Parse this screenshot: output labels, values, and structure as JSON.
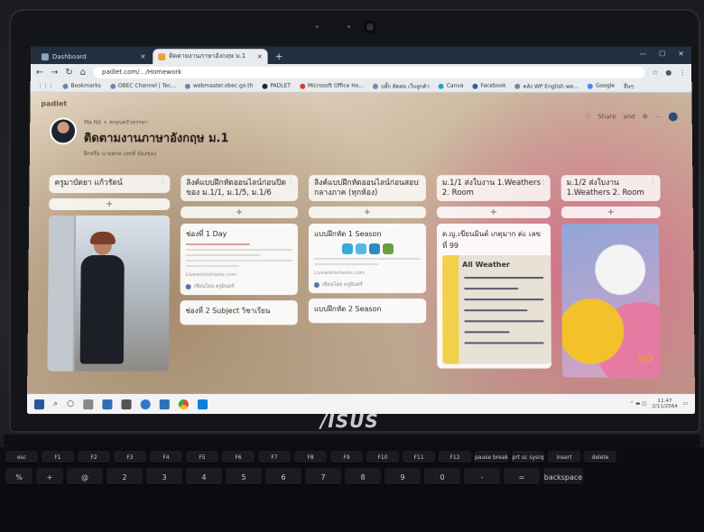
{
  "browser": {
    "tabs": [
      {
        "label": "Dashboard",
        "active": false
      },
      {
        "label": "ติดตามงานภาษาอังกฤษ ม.1",
        "active": true
      }
    ],
    "url": "padlet.com/…/Homework",
    "bookmarks": [
      "Bookmarks",
      "OBEC Channel | Tec...",
      "webmaster.obec.go.th",
      "PADLET",
      "Microsoft Office Ho...",
      "ปลั๊ก ติดต่อ เว็บลูกค้า",
      "Canva",
      "Facebook",
      "คลัง WP English we...",
      "Google",
      "อื่นๆ"
    ]
  },
  "padlet": {
    "logo": "padlet",
    "author": "Ma Nit + ครอบครัวหรรษา",
    "title": "ติดตามงานภาษาอังกฤษ ม.1",
    "subtitle": "ฝึกหรือ นายสกล เลขที่ ห้องของ",
    "tools": [
      "Share",
      "and"
    ],
    "columns": [
      {
        "title": "ครูมาบัดยา แก้วรัตน์",
        "add": "+",
        "cards": []
      },
      {
        "title": "ลิงค์แบบฝึกหัดออนไลน์ก่อนปิดของ ม.1/1, ม.1/5, ม.1/6",
        "add": "+",
        "cards": [
          {
            "title": "ช่องที่ 1 Day",
            "link": "Liveworksheets.com",
            "author": "เขียนโดย ครูมินทร์"
          },
          {
            "title": "ช่องที่ 2 Subject วิชาเรียน"
          }
        ]
      },
      {
        "title": "ลิงค์แบบฝึกหัดออนไลน์ก่อนสอบกลางภาค (ทุกห้อง)",
        "add": "+",
        "cards": [
          {
            "title": "แบบฝึกหัด 1 Season",
            "link": "Liveworksheets.com",
            "author": "เขียนโดย ครูมินทร์"
          },
          {
            "title": "แบบฝึกหัด 2 Season"
          }
        ]
      },
      {
        "title": "ม.1/1 ส่งใบงาน 1.Weathers 2. Room",
        "add": "+",
        "cards": [
          {
            "title": "ด.ญ.เขียนมินต์ เกตุมาก ต่ะ เลขที่ 99",
            "poster_text": "All Weather"
          }
        ]
      },
      {
        "title": "ม.1/2 ส่งใบงาน 1.Weathers 2. Room",
        "add": "+",
        "cards": [
          {
            "art_text": "XO"
          }
        ]
      }
    ]
  },
  "taskbar": {
    "time": "11:47",
    "date": "2/11/2564"
  },
  "laptop": {
    "brand": "/ISUS"
  },
  "keyboard": {
    "row1": [
      "esc",
      "F1",
      "F2",
      "F3",
      "F4",
      "F5",
      "F6",
      "F7",
      "F8",
      "F9",
      "F10",
      "F11",
      "F12",
      "pause break",
      "prt sc sysrq",
      "insert",
      "delete"
    ],
    "row2": [
      "%",
      "+",
      "@",
      "2",
      "3",
      "4",
      "5",
      "6",
      "7",
      "8",
      "9",
      "0",
      "-",
      "=",
      "backspace"
    ]
  }
}
